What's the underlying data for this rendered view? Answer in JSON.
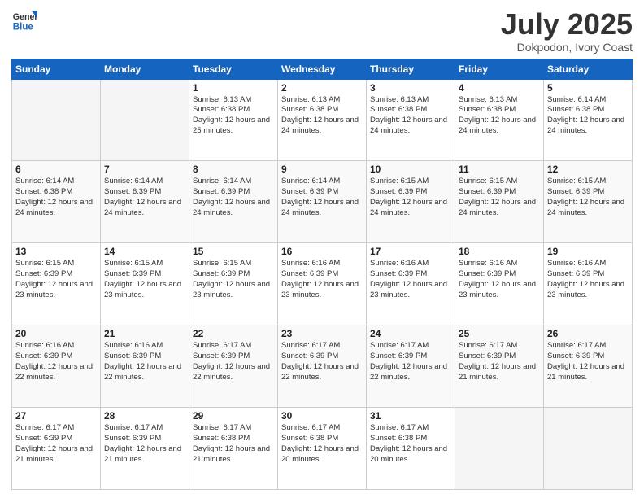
{
  "logo": {
    "general": "General",
    "blue": "Blue"
  },
  "title": {
    "month": "July 2025",
    "location": "Dokpodon, Ivory Coast"
  },
  "weekdays": [
    "Sunday",
    "Monday",
    "Tuesday",
    "Wednesday",
    "Thursday",
    "Friday",
    "Saturday"
  ],
  "weeks": [
    [
      {
        "day": null
      },
      {
        "day": null
      },
      {
        "day": "1",
        "sunrise": "Sunrise: 6:13 AM",
        "sunset": "Sunset: 6:38 PM",
        "daylight": "Daylight: 12 hours and 25 minutes."
      },
      {
        "day": "2",
        "sunrise": "Sunrise: 6:13 AM",
        "sunset": "Sunset: 6:38 PM",
        "daylight": "Daylight: 12 hours and 24 minutes."
      },
      {
        "day": "3",
        "sunrise": "Sunrise: 6:13 AM",
        "sunset": "Sunset: 6:38 PM",
        "daylight": "Daylight: 12 hours and 24 minutes."
      },
      {
        "day": "4",
        "sunrise": "Sunrise: 6:13 AM",
        "sunset": "Sunset: 6:38 PM",
        "daylight": "Daylight: 12 hours and 24 minutes."
      },
      {
        "day": "5",
        "sunrise": "Sunrise: 6:14 AM",
        "sunset": "Sunset: 6:38 PM",
        "daylight": "Daylight: 12 hours and 24 minutes."
      }
    ],
    [
      {
        "day": "6",
        "sunrise": "Sunrise: 6:14 AM",
        "sunset": "Sunset: 6:38 PM",
        "daylight": "Daylight: 12 hours and 24 minutes."
      },
      {
        "day": "7",
        "sunrise": "Sunrise: 6:14 AM",
        "sunset": "Sunset: 6:39 PM",
        "daylight": "Daylight: 12 hours and 24 minutes."
      },
      {
        "day": "8",
        "sunrise": "Sunrise: 6:14 AM",
        "sunset": "Sunset: 6:39 PM",
        "daylight": "Daylight: 12 hours and 24 minutes."
      },
      {
        "day": "9",
        "sunrise": "Sunrise: 6:14 AM",
        "sunset": "Sunset: 6:39 PM",
        "daylight": "Daylight: 12 hours and 24 minutes."
      },
      {
        "day": "10",
        "sunrise": "Sunrise: 6:15 AM",
        "sunset": "Sunset: 6:39 PM",
        "daylight": "Daylight: 12 hours and 24 minutes."
      },
      {
        "day": "11",
        "sunrise": "Sunrise: 6:15 AM",
        "sunset": "Sunset: 6:39 PM",
        "daylight": "Daylight: 12 hours and 24 minutes."
      },
      {
        "day": "12",
        "sunrise": "Sunrise: 6:15 AM",
        "sunset": "Sunset: 6:39 PM",
        "daylight": "Daylight: 12 hours and 24 minutes."
      }
    ],
    [
      {
        "day": "13",
        "sunrise": "Sunrise: 6:15 AM",
        "sunset": "Sunset: 6:39 PM",
        "daylight": "Daylight: 12 hours and 23 minutes."
      },
      {
        "day": "14",
        "sunrise": "Sunrise: 6:15 AM",
        "sunset": "Sunset: 6:39 PM",
        "daylight": "Daylight: 12 hours and 23 minutes."
      },
      {
        "day": "15",
        "sunrise": "Sunrise: 6:15 AM",
        "sunset": "Sunset: 6:39 PM",
        "daylight": "Daylight: 12 hours and 23 minutes."
      },
      {
        "day": "16",
        "sunrise": "Sunrise: 6:16 AM",
        "sunset": "Sunset: 6:39 PM",
        "daylight": "Daylight: 12 hours and 23 minutes."
      },
      {
        "day": "17",
        "sunrise": "Sunrise: 6:16 AM",
        "sunset": "Sunset: 6:39 PM",
        "daylight": "Daylight: 12 hours and 23 minutes."
      },
      {
        "day": "18",
        "sunrise": "Sunrise: 6:16 AM",
        "sunset": "Sunset: 6:39 PM",
        "daylight": "Daylight: 12 hours and 23 minutes."
      },
      {
        "day": "19",
        "sunrise": "Sunrise: 6:16 AM",
        "sunset": "Sunset: 6:39 PM",
        "daylight": "Daylight: 12 hours and 23 minutes."
      }
    ],
    [
      {
        "day": "20",
        "sunrise": "Sunrise: 6:16 AM",
        "sunset": "Sunset: 6:39 PM",
        "daylight": "Daylight: 12 hours and 22 minutes."
      },
      {
        "day": "21",
        "sunrise": "Sunrise: 6:16 AM",
        "sunset": "Sunset: 6:39 PM",
        "daylight": "Daylight: 12 hours and 22 minutes."
      },
      {
        "day": "22",
        "sunrise": "Sunrise: 6:17 AM",
        "sunset": "Sunset: 6:39 PM",
        "daylight": "Daylight: 12 hours and 22 minutes."
      },
      {
        "day": "23",
        "sunrise": "Sunrise: 6:17 AM",
        "sunset": "Sunset: 6:39 PM",
        "daylight": "Daylight: 12 hours and 22 minutes."
      },
      {
        "day": "24",
        "sunrise": "Sunrise: 6:17 AM",
        "sunset": "Sunset: 6:39 PM",
        "daylight": "Daylight: 12 hours and 22 minutes."
      },
      {
        "day": "25",
        "sunrise": "Sunrise: 6:17 AM",
        "sunset": "Sunset: 6:39 PM",
        "daylight": "Daylight: 12 hours and 21 minutes."
      },
      {
        "day": "26",
        "sunrise": "Sunrise: 6:17 AM",
        "sunset": "Sunset: 6:39 PM",
        "daylight": "Daylight: 12 hours and 21 minutes."
      }
    ],
    [
      {
        "day": "27",
        "sunrise": "Sunrise: 6:17 AM",
        "sunset": "Sunset: 6:39 PM",
        "daylight": "Daylight: 12 hours and 21 minutes."
      },
      {
        "day": "28",
        "sunrise": "Sunrise: 6:17 AM",
        "sunset": "Sunset: 6:39 PM",
        "daylight": "Daylight: 12 hours and 21 minutes."
      },
      {
        "day": "29",
        "sunrise": "Sunrise: 6:17 AM",
        "sunset": "Sunset: 6:38 PM",
        "daylight": "Daylight: 12 hours and 21 minutes."
      },
      {
        "day": "30",
        "sunrise": "Sunrise: 6:17 AM",
        "sunset": "Sunset: 6:38 PM",
        "daylight": "Daylight: 12 hours and 20 minutes."
      },
      {
        "day": "31",
        "sunrise": "Sunrise: 6:17 AM",
        "sunset": "Sunset: 6:38 PM",
        "daylight": "Daylight: 12 hours and 20 minutes."
      },
      {
        "day": null
      },
      {
        "day": null
      }
    ]
  ]
}
